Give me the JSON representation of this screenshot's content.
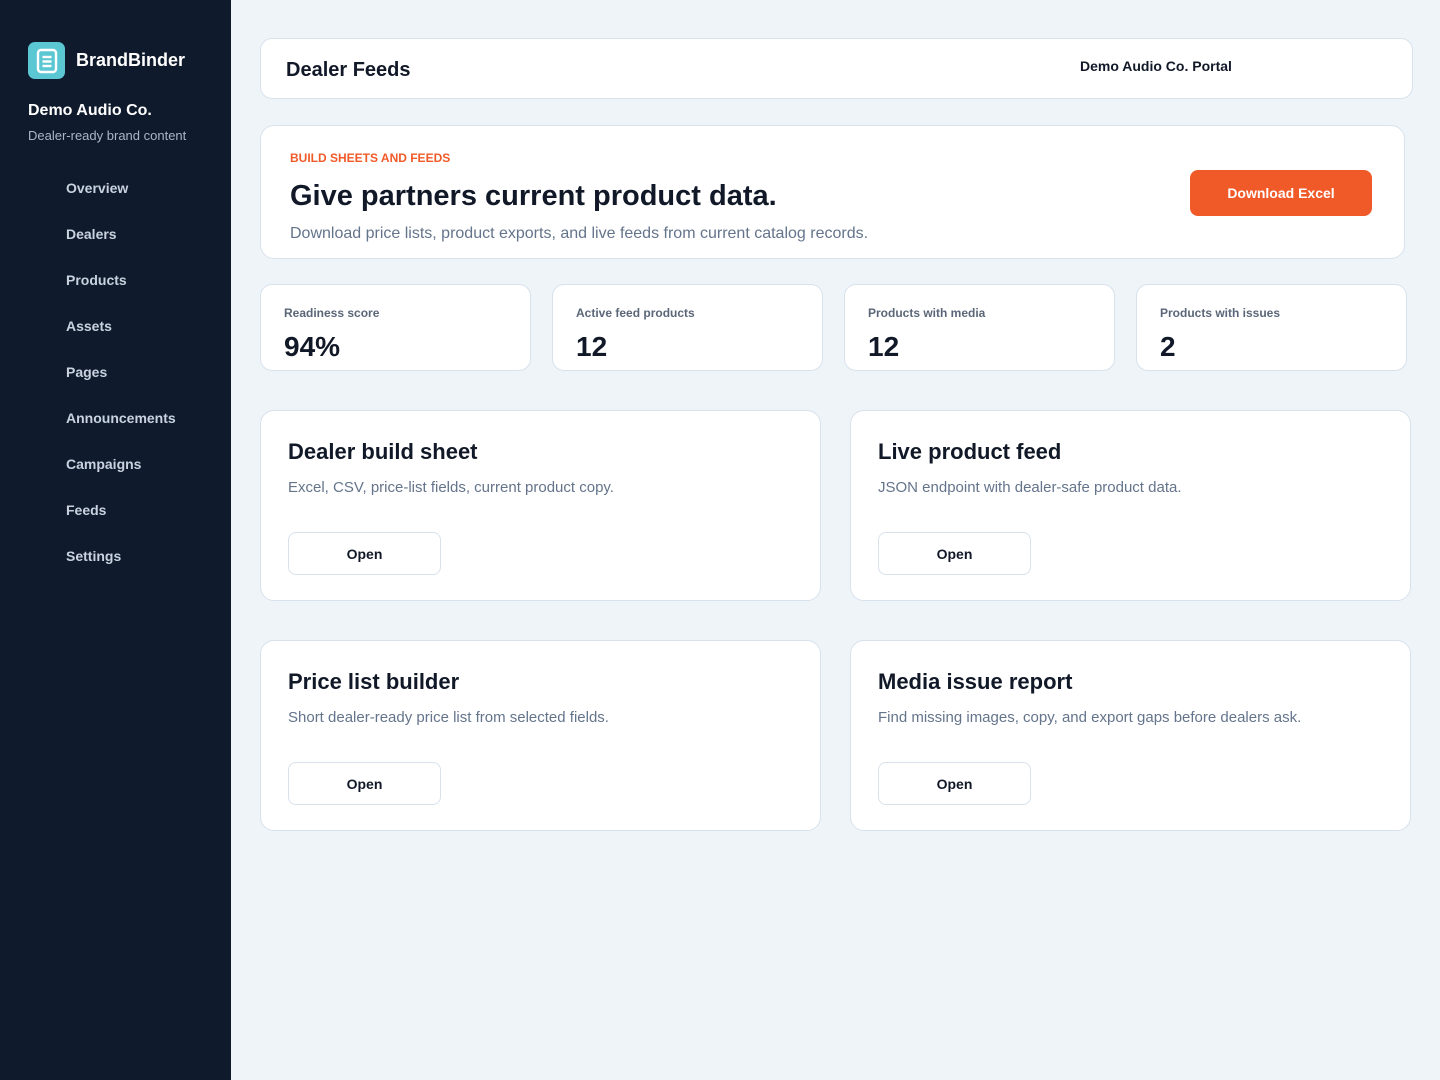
{
  "sidebar": {
    "brand_name": "BrandBinder",
    "logo_icon": "document-list-icon",
    "org_name": "Demo Audio Co.",
    "org_tagline": "Dealer-ready brand content",
    "nav": [
      "Overview",
      "Dealers",
      "Products",
      "Assets",
      "Pages",
      "Announcements",
      "Campaigns",
      "Feeds",
      "Settings"
    ]
  },
  "header": {
    "title": "Dealer Feeds",
    "portal_label": "Demo Audio Co. Portal"
  },
  "hero": {
    "eyebrow": "BUILD SHEETS AND FEEDS",
    "title": "Give partners current product data.",
    "description": "Download price lists, product exports, and live feeds from current catalog records.",
    "button_label": "Download Excel"
  },
  "stats": [
    {
      "label": "Readiness score",
      "value": "94%"
    },
    {
      "label": "Active feed products",
      "value": "12"
    },
    {
      "label": "Products with media",
      "value": "12"
    },
    {
      "label": "Products with issues",
      "value": "2"
    }
  ],
  "cards": [
    {
      "title": "Dealer build sheet",
      "description": "Excel, CSV, price-list fields, current product copy.",
      "button_label": "Open"
    },
    {
      "title": "Live product feed",
      "description": "JSON endpoint with dealer-safe product data.",
      "button_label": "Open"
    },
    {
      "title": "Price list builder",
      "description": "Short dealer-ready price list from selected fields.",
      "button_label": "Open"
    },
    {
      "title": "Media issue report",
      "description": "Find missing images, copy, and export gaps before dealers ask.",
      "button_label": "Open"
    }
  ],
  "colors": {
    "sidebar_bg": "#0f1b2d",
    "accent": "#f05a28",
    "logo": "#5bc7d3",
    "page_bg": "#eff4f8"
  }
}
